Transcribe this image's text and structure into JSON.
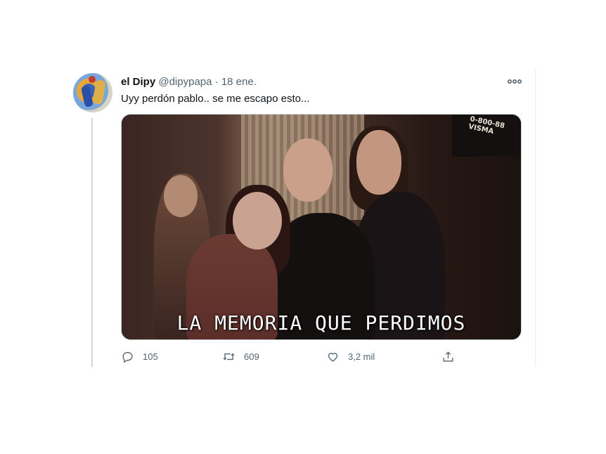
{
  "tweet": {
    "author_name": "el Dipy",
    "handle": "@dipypapa",
    "separator": "·",
    "date": "18 ene.",
    "text": "Uyy perdón pablo.. se me escapo esto...",
    "media": {
      "caption": "LA MEMORIA QUE PERDIMOS",
      "sign_text": "0-800-88\nVISMA"
    },
    "actions": {
      "replies": "105",
      "retweets": "609",
      "likes": "3,2 mil"
    }
  },
  "icons": {
    "more": "more-dots-icon",
    "reply": "reply-bubble-icon",
    "retweet": "retweet-icon",
    "like": "heart-icon",
    "share": "share-icon"
  },
  "colors": {
    "secondary_text": "#536471",
    "primary_text": "#0f1419",
    "border": "#cfd9de"
  }
}
